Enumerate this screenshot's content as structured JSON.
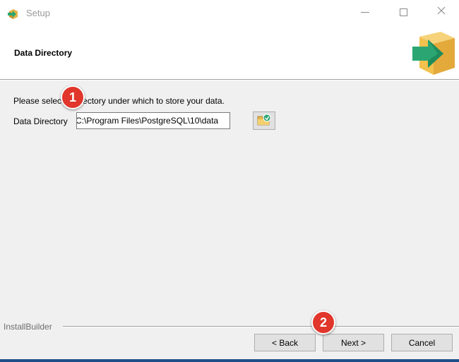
{
  "window": {
    "title": "Setup",
    "icon": "setup-box-arrow-icon",
    "controls": {
      "minimize": "minimize-icon",
      "maximize": "maximize-icon",
      "close": "close-icon"
    }
  },
  "header": {
    "title": "Data Directory",
    "logo_icon": "box-arrow-logo-icon"
  },
  "main": {
    "instruction": "Please select a directory under which to store your data.",
    "data_directory": {
      "label": "Data Directory",
      "value": "C:\\Program Files\\PostgreSQL\\10\\data",
      "browse_icon": "folder-browse-icon"
    }
  },
  "callouts": [
    "1",
    "2"
  ],
  "footer": {
    "brand": "InstallBuilder",
    "back_label": "< Back",
    "next_label": "Next >",
    "cancel_label": "Cancel"
  },
  "colors": {
    "callout": "#e0362b",
    "dialog_bg": "#f0f0f0",
    "logo_box": "#f2c14e",
    "logo_arrow": "#2ba672"
  }
}
